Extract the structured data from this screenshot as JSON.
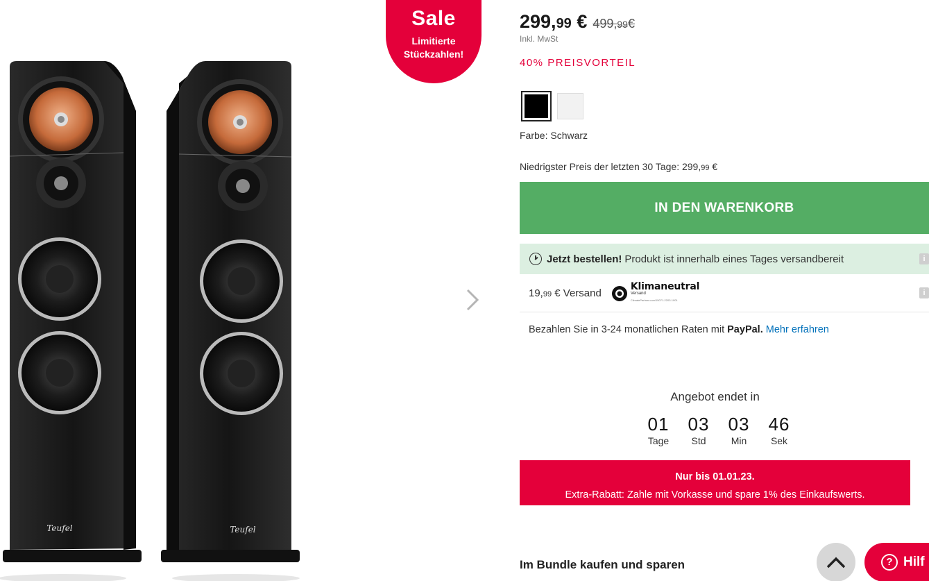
{
  "sale_badge": {
    "title": "Sale",
    "line1": "Limitierte",
    "line2": "Stückzahlen!"
  },
  "price": {
    "main_euros": "299,",
    "main_cents": "99",
    "main_currency": " €",
    "old_euros": "499,",
    "old_cents": "99",
    "old_currency": "€",
    "vat_note": "Inkl. MwSt",
    "discount": "40% PREISVORTEIL"
  },
  "colors": {
    "options": [
      "#000000",
      "#f2f2f2"
    ],
    "selected_label": "Farbe: Schwarz"
  },
  "lowest_price": {
    "text": "Niedrigster Preis der letzten 30 Tage: 299,",
    "cents": "99",
    "currency": " €"
  },
  "cart_button": "IN DEN WARENKORB",
  "availability": {
    "bold": "Jetzt bestellen!",
    "text": "Produkt ist innerhalb eines Tages versandbereit"
  },
  "shipping": {
    "price_euros": "19,",
    "price_cents": "99",
    "label": " € Versand",
    "klima_title": "Klimaneutral",
    "klima_sub": "Versand",
    "klima_tiny": "ClimatePartner.com/15071-2203-1001"
  },
  "paypal": {
    "prefix": "Bezahlen Sie in 3-24 monatlichen Raten mit ",
    "brand": "PayPal.",
    "link": "Mehr erfahren"
  },
  "countdown": {
    "title": "Angebot endet in",
    "units": [
      {
        "value": "01",
        "label": "Tage"
      },
      {
        "value": "03",
        "label": "Std"
      },
      {
        "value": "03",
        "label": "Min"
      },
      {
        "value": "46",
        "label": "Sek"
      }
    ]
  },
  "promo": {
    "line1": "Nur bis 01.01.23.",
    "line2": "Extra-Rabatt: Zahle mit Vorkasse und spare 1% des Einkaufswerts."
  },
  "bundle_title": "Im Bundle kaufen und sparen",
  "help_button": "Hilf",
  "speaker_brand": "Teufel",
  "accent_colors": {
    "sale_red": "#e4003a",
    "cart_green": "#54ad64",
    "ship_bg": "#dcefe1",
    "paypal_blue": "#0070ba"
  }
}
